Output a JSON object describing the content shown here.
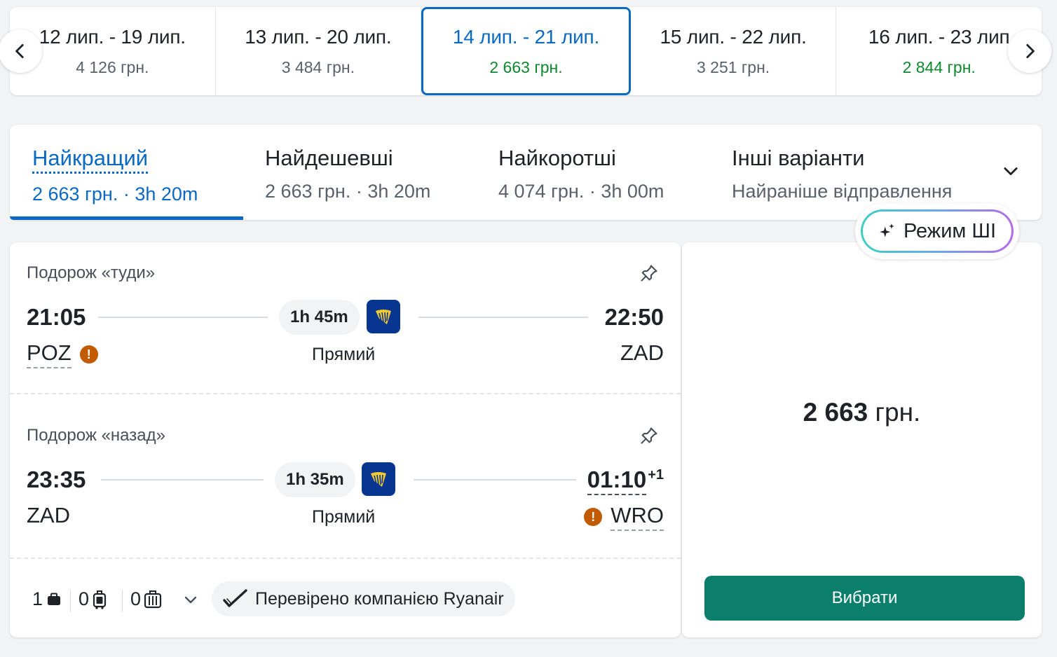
{
  "date_strip": {
    "cells": [
      {
        "dates": "12 лип. - 19 лип.",
        "price": "4 126 грн.",
        "cheap": false,
        "selected": false
      },
      {
        "dates": "13 лип. - 20 лип.",
        "price": "3 484 грн.",
        "cheap": false,
        "selected": false
      },
      {
        "dates": "14 лип. - 21 лип.",
        "price": "2 663 грн.",
        "cheap": true,
        "selected": true
      },
      {
        "dates": "15 лип. - 22 лип.",
        "price": "3 251 грн.",
        "cheap": false,
        "selected": false
      },
      {
        "dates": "16 лип. - 23 лип",
        "price": "2 844 грн.",
        "cheap": true,
        "selected": false
      }
    ],
    "prev_icon": "chevron-left-icon",
    "next_icon": "chevron-right-icon"
  },
  "sort_tabs": [
    {
      "label": "Найкращий",
      "sub": "2 663 грн. · 3h 20m",
      "active": true
    },
    {
      "label": "Найдешевші",
      "sub": "2 663 грн. · 3h 20m",
      "active": false
    },
    {
      "label": "Найкоротші",
      "sub": "4 074 грн. · 3h 00m",
      "active": false
    },
    {
      "label": "Інші варіанти",
      "sub": "Найраніше відправлення",
      "active": false
    }
  ],
  "ai_mode": {
    "label": "Режим ШІ",
    "icon": "sparkle-icon"
  },
  "itinerary": {
    "outbound": {
      "title": "Подорож «туди»",
      "depart_time": "21:05",
      "arrive_time": "22:50",
      "duration": "1h 45m",
      "stops": "Прямий",
      "from": "POZ",
      "to": "ZAD",
      "warning_on": "from"
    },
    "return": {
      "title": "Подорож «назад»",
      "depart_time": "23:35",
      "arrive_time": "01:10",
      "day_offset": "+1",
      "duration": "1h 35m",
      "stops": "Прямий",
      "from": "ZAD",
      "to": "WRO",
      "warning_on": "to"
    },
    "airline_logo": "ryanair-harp-icon",
    "baggage": {
      "personal_item": "1",
      "carry_on": "0",
      "checked": "0"
    },
    "verified": "Перевірено компанією Ryanair"
  },
  "price_panel": {
    "price_number": "2 663",
    "price_currency": " грн.",
    "select_label": "Вибрати"
  },
  "colors": {
    "accent_blue": "#0969c3",
    "cheap_green": "#0e8a2e",
    "select_button": "#0b7f6c",
    "warning": "#c25a00",
    "ryanair_blue": "#073590"
  }
}
